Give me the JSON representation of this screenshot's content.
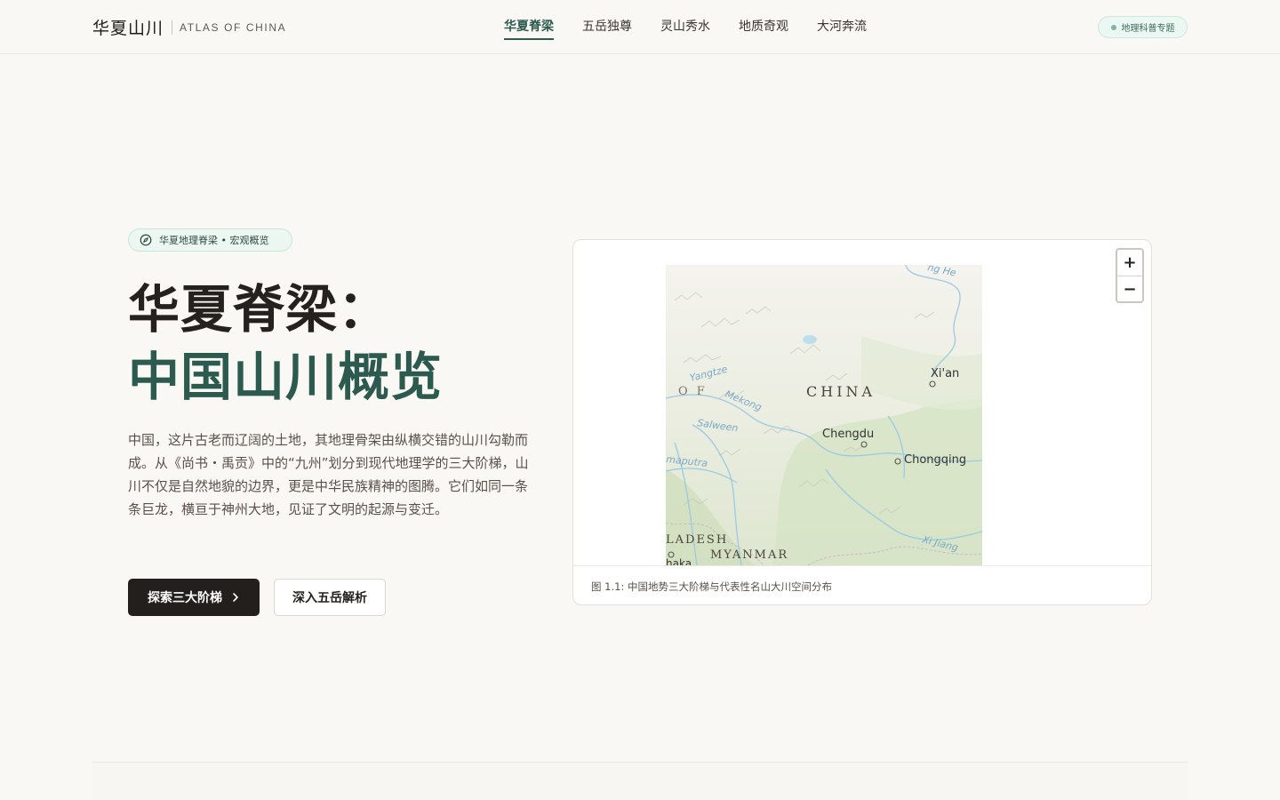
{
  "header": {
    "brand_cn": "华夏山川",
    "brand_en": "ATLAS OF CHINA",
    "nav": [
      {
        "label": "华夏脊梁",
        "active": true
      },
      {
        "label": "五岳独尊",
        "active": false
      },
      {
        "label": "灵山秀水",
        "active": false
      },
      {
        "label": "地质奇观",
        "active": false
      },
      {
        "label": "大河奔流",
        "active": false
      }
    ],
    "topic_badge": "地理科普专题"
  },
  "hero": {
    "pill_label": "华夏地理脊梁 • 宏观概览",
    "pill_icon": "compass-icon",
    "title_line1": "华夏脊梁：",
    "title_line2": "中国山川概览",
    "lead": "中国，这片古老而辽阔的土地，其地理骨架由纵横交错的山川勾勒而成。从《尚书・禹贡》中的“九州”划分到现代地理学的三大阶梯，山川不仅是自然地貌的边界，更是中华民族精神的图腾。它们如同一条条巨龙，横亘于神州大地，见证了文明的起源与变迁。",
    "primary_button": "探索三大阶梯",
    "secondary_button": "深入五岳解析"
  },
  "map": {
    "labels": {
      "top_river": "ng He",
      "yangtze": "Yangtze",
      "of": "O F",
      "mekong": "Mekong",
      "china": "CHINA",
      "xian": "Xi'an",
      "salween": "Salween",
      "chengdu": "Chengdu",
      "brahmaputra": "maputra",
      "chongqing": "Chongqing",
      "bangladesh": "LADESH",
      "myanmar": "MYANMAR",
      "xijiang": "Xi Jiang",
      "dhaka": "haka"
    },
    "zoom_in": "+",
    "zoom_out": "−",
    "caption": "图 1.1: 中国地势三大阶梯与代表性名山大川空间分布"
  },
  "colors": {
    "accent": "#2c5a4e",
    "dark": "#221f1c",
    "background": "#faf8f5"
  }
}
